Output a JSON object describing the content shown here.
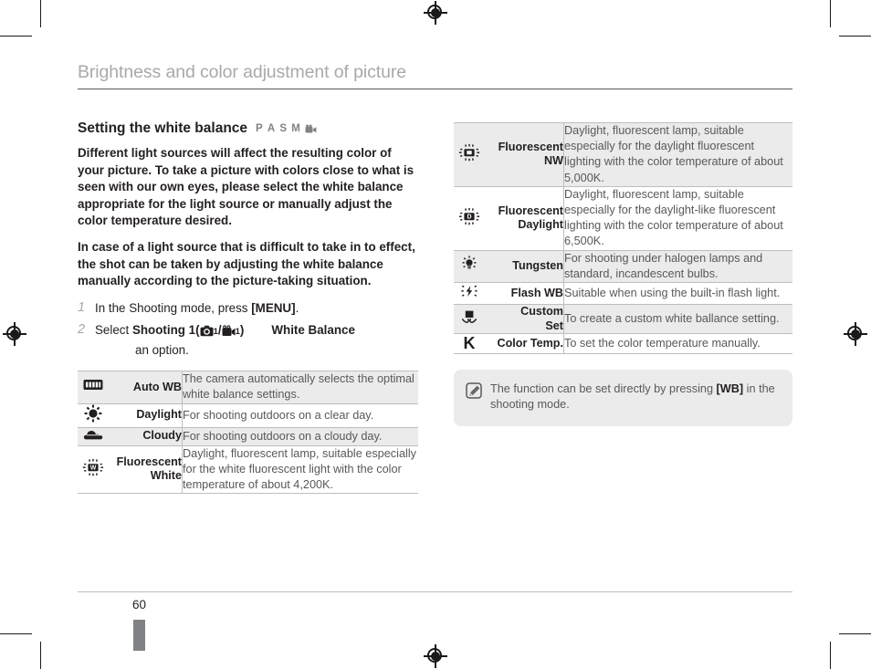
{
  "header": {
    "title": "Brightness and color adjustment of picture"
  },
  "section": {
    "heading": "Setting the white balance",
    "mode_badges": [
      "P",
      "A",
      "S",
      "M"
    ],
    "mode_video_icon": "video-camera-icon",
    "paragraphs": [
      "Different light sources will affect the resulting color of your picture. To take a picture with colors close to what is seen with our own eyes, please select the white balance appropriate for the light source or manually adjust the color temperature desired.",
      "In case of a light source that is difficult to take in to effect,  the shot can be taken by adjusting the white balance manually according to the picture-taking situation."
    ]
  },
  "steps": [
    {
      "num": "1",
      "text_before": "In the Shooting mode, press ",
      "bold": "[MENU]",
      "text_after": "."
    },
    {
      "num": "2",
      "text_before": "Select ",
      "bold": "Shooting 1",
      "paren_open": "(",
      "icon_photo": "camera-icon",
      "sub_photo": "1",
      "separator": "/",
      "icon_video": "camcorder-icon",
      "sub_video": "1",
      "paren_close": ")",
      "bold2": "White Balance",
      "text_after": "an option."
    }
  ],
  "left_table": {
    "rows": [
      {
        "icon": "auto-wb-icon",
        "name": "Auto WB",
        "desc": "The camera automatically selects the optimal white balance settings.",
        "shaded": true
      },
      {
        "icon": "daylight-sun-icon",
        "name": "Daylight",
        "desc": "For shooting outdoors on a clear day.",
        "shaded": false
      },
      {
        "icon": "cloudy-cloud-icon",
        "name": "Cloudy",
        "desc": "For shooting outdoors on a cloudy day.",
        "shaded": true
      },
      {
        "icon": "fluorescent-white-icon",
        "name": "Fluorescent White",
        "name_line1": "Fluorescent",
        "name_line2": "White",
        "desc": "Daylight, fluorescent lamp, suitable especially for the white fluorescent light with the color temperature of about 4,200K.",
        "shaded": false
      }
    ]
  },
  "right_table": {
    "rows": [
      {
        "icon": "fluorescent-nw-icon",
        "name_line1": "Fluorescent",
        "name_line2": "NW",
        "desc": "Daylight, fluorescent lamp, suitable especially for the daylight fluorescent lighting with the color temperature of about 5,000K.",
        "shaded": true
      },
      {
        "icon": "fluorescent-daylight-icon",
        "name_line1": "Fluorescent",
        "name_line2": "Daylight",
        "desc": "Daylight, fluorescent lamp, suitable especially for the daylight-like fluorescent lighting with the color temperature of about 6,500K.",
        "shaded": false
      },
      {
        "icon": "tungsten-icon",
        "name_line1": "Tungsten",
        "name_line2": "",
        "desc": "For shooting under halogen lamps and standard, incandescent bulbs.",
        "shaded": true
      },
      {
        "icon": "flash-wb-icon",
        "name_line1": "Flash WB",
        "name_line2": "",
        "desc": "Suitable when using the built-in flash light.",
        "shaded": false
      },
      {
        "icon": "custom-set-icon",
        "name_line1": "Custom",
        "name_line2": "Set",
        "desc": "To create a custom white ballance setting.",
        "shaded": true
      },
      {
        "icon": "color-temp-kelvin-icon",
        "name_line1": "Color Temp.",
        "name_line2": "",
        "desc": "To set the color temperature manually.",
        "shaded": false
      }
    ]
  },
  "note": {
    "icon": "note-pencil-icon",
    "text_before": "The function can be set directly by pressing ",
    "bold": "[WB]",
    "text_after": " in the shooting mode."
  },
  "footer": {
    "page_number": "60"
  },
  "colors": {
    "header_title": "#a7a9ac",
    "body_text": "#231f20",
    "desc_text": "#58595b",
    "row_shade": "#ebebeb",
    "rule": "#bcbec0",
    "tab": "#808285"
  }
}
